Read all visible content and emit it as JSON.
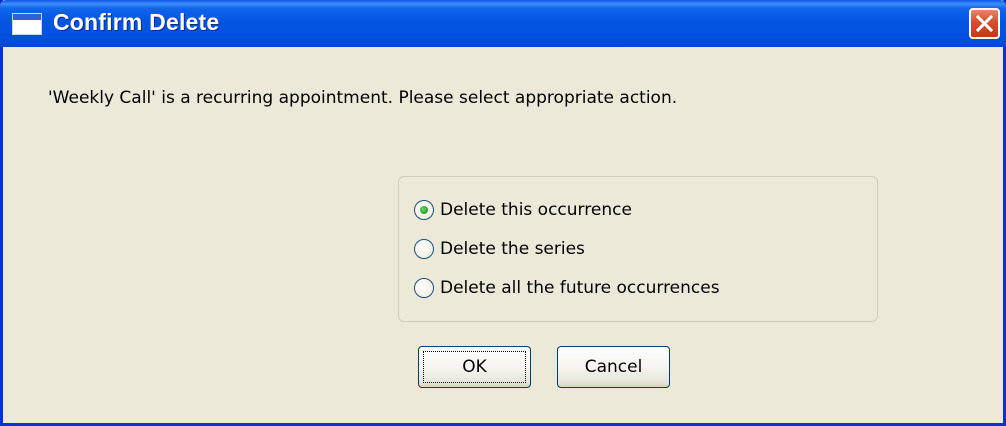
{
  "window": {
    "title": "Confirm Delete",
    "close_icon": "close-icon",
    "app_icon": "window-icon"
  },
  "dialog": {
    "message": "'Weekly Call' is a recurring appointment. Please select appropriate action.",
    "options": [
      {
        "label": "Delete this occurrence",
        "selected": true
      },
      {
        "label": "Delete the series",
        "selected": false
      },
      {
        "label": "Delete all the future occurrences",
        "selected": false
      }
    ],
    "ok_label": "OK",
    "cancel_label": "Cancel"
  },
  "colors": {
    "titlebar": "#0455e3",
    "background": "#ece9d8",
    "close_button": "#d4502e",
    "radio_selected": "#21a121"
  }
}
